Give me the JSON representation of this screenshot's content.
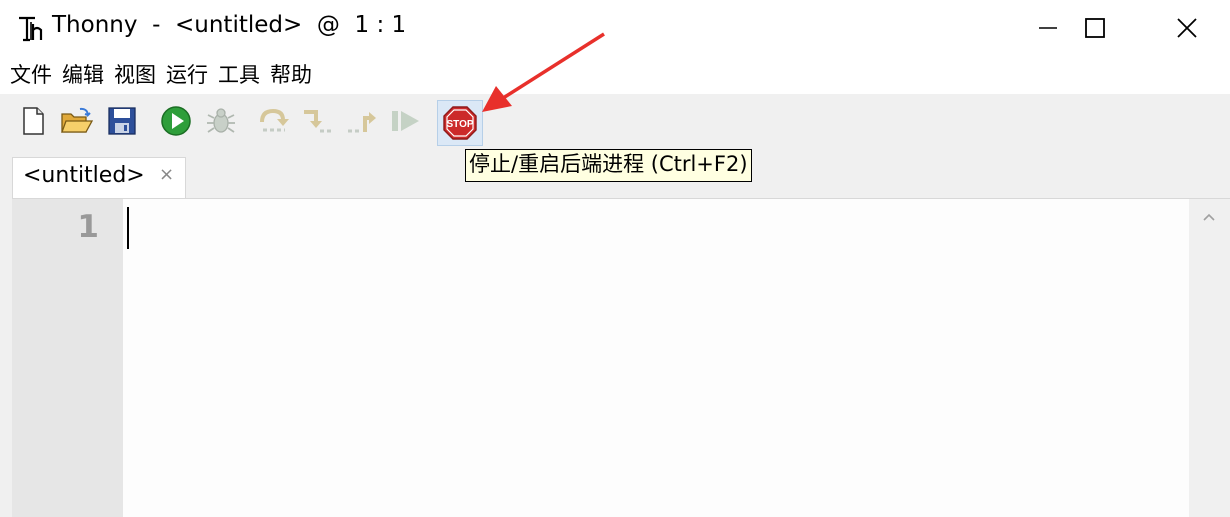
{
  "window": {
    "title": "Thonny  -  <untitled>  @  1 : 1",
    "controls": [
      "minimize",
      "maximize",
      "close"
    ]
  },
  "menu": {
    "items": [
      "文件",
      "编辑",
      "视图",
      "运行",
      "工具",
      "帮助"
    ]
  },
  "toolbar": {
    "buttons": [
      {
        "name": "new-file-icon",
        "enabled": true
      },
      {
        "name": "open-folder-icon",
        "enabled": true
      },
      {
        "name": "save-icon",
        "enabled": true
      },
      {
        "name": "run-icon",
        "enabled": true
      },
      {
        "name": "debug-icon",
        "enabled": false
      },
      {
        "name": "step-over-icon",
        "enabled": false
      },
      {
        "name": "step-into-icon",
        "enabled": false
      },
      {
        "name": "step-out-icon",
        "enabled": false
      },
      {
        "name": "resume-icon",
        "enabled": false
      },
      {
        "name": "stop-icon",
        "enabled": true,
        "hovered": true
      }
    ],
    "stop_text": "STOP",
    "tooltip": "停止/重启后端进程 (Ctrl+F2)"
  },
  "tabs": [
    {
      "label": "<untitled>",
      "close": "×"
    }
  ],
  "editor": {
    "line_numbers": [
      "1"
    ],
    "content": ""
  },
  "colors": {
    "chrome": "#f0f0f0",
    "gutter": "#e6e6e6",
    "tooltip_bg": "#ffffe1",
    "annotation": "#e8302b",
    "run_green": "#2e9e3a",
    "stop_red": "#cc2a2a"
  }
}
